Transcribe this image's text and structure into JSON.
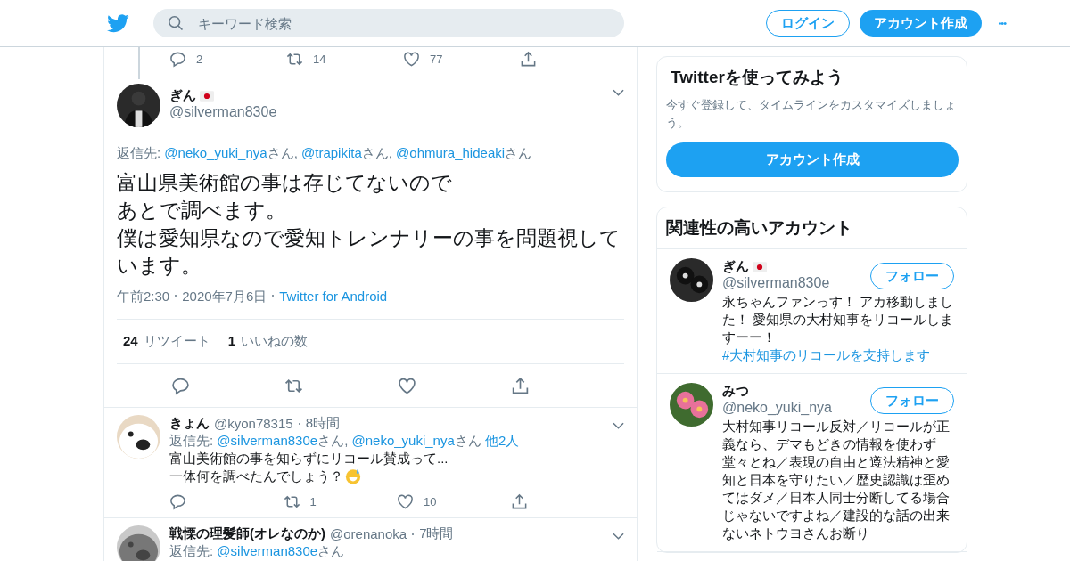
{
  "header": {
    "search": {
      "placeholder": "キーワード検索"
    },
    "login": "ログイン",
    "signup": "アカウント作成",
    "more": "•••"
  },
  "thread_top": {
    "actions": [
      {
        "kind": "reply",
        "count": "2"
      },
      {
        "kind": "retweet",
        "count": "14"
      },
      {
        "kind": "like",
        "count": "77"
      },
      {
        "kind": "share"
      }
    ]
  },
  "main_tweet": {
    "name": "ぎん",
    "flag": true,
    "handle": "@silverman830e",
    "reply_to": [
      {
        "kind": "plain",
        "text": "返信先: "
      },
      {
        "kind": "link",
        "text": "@neko_yuki_nya"
      },
      {
        "kind": "plain",
        "text": "さん, "
      },
      {
        "kind": "link",
        "text": "@trapikita"
      },
      {
        "kind": "plain",
        "text": "さん, "
      },
      {
        "kind": "link",
        "text": "@ohmura_hideaki"
      },
      {
        "kind": "plain",
        "text": "さん"
      }
    ],
    "text": [
      "富山県美術館の事は存じてないので",
      "あとで調べます。",
      "僕は愛知県なので愛知トレンナリーの事を問題視しています。"
    ],
    "time": "午前2:30",
    "date": "2020年7月6日",
    "source": "Twitter for Android",
    "stats": [
      {
        "count": "24",
        "label": "リツイート"
      },
      {
        "count": "1",
        "label": "いいねの数"
      }
    ],
    "actions": [
      {
        "kind": "reply"
      },
      {
        "kind": "retweet"
      },
      {
        "kind": "like"
      },
      {
        "kind": "share"
      }
    ]
  },
  "replies": [
    {
      "name": "きょん",
      "handle": "@kyon78315",
      "age": "8時間",
      "reply_to": [
        {
          "kind": "plain",
          "text": "返信先: "
        },
        {
          "kind": "link",
          "text": "@silverman830e"
        },
        {
          "kind": "plain",
          "text": "さん, "
        },
        {
          "kind": "link",
          "text": "@neko_yuki_nya"
        },
        {
          "kind": "plain",
          "text": "さん "
        },
        {
          "kind": "link",
          "text": "他2人"
        }
      ],
      "lines": [
        "富山美術館の事を知らずにリコール賛成って...",
        "一体何を調べたんでしょう？"
      ],
      "emoji": true,
      "actions": [
        {
          "kind": "reply"
        },
        {
          "kind": "retweet",
          "count": "1"
        },
        {
          "kind": "like",
          "count": "10"
        },
        {
          "kind": "share"
        }
      ]
    },
    {
      "name": "戦慄の理髪師(オレなのか)",
      "handle": "@orenanoka",
      "age": "7時間",
      "reply_to": [
        {
          "kind": "plain",
          "text": "返信先: "
        },
        {
          "kind": "link",
          "text": "@silverman830e"
        },
        {
          "kind": "plain",
          "text": "さん"
        }
      ]
    }
  ],
  "sidebar": {
    "signup_card": {
      "title": "Twitterを使ってみよう",
      "text": "今すぐ登録して、タイムラインをカスタマイズしましょう。",
      "button": "アカウント作成"
    },
    "related": {
      "title": "関連性の高いアカウント",
      "accounts": [
        {
          "name": "ぎん",
          "flag": true,
          "handle": "@silverman830e",
          "follow": "フォロー",
          "bio": [
            {
              "kind": "plain",
              "text": "永ちゃんファンっす！ アカ移動しました！ 愛知県の大村知事をリコールしますーー！　"
            },
            {
              "kind": "link",
              "text": "#大村知事のリコールを支持します"
            }
          ]
        },
        {
          "name": "みつ",
          "flag": false,
          "handle": "@neko_yuki_nya",
          "follow": "フォロー",
          "bio": [
            {
              "kind": "plain",
              "text": "大村知事リコール反対／リコールが正義なら、デマもどきの情報を使わず堂々とね／表現の自由と遵法精神と愛知と日本を守りたい／歴史認識は歪めてはダメ／日本人同士分断してる場合じゃないですよね／建設的な話の出来ないネトウヨさんお断り"
            }
          ]
        }
      ]
    }
  }
}
